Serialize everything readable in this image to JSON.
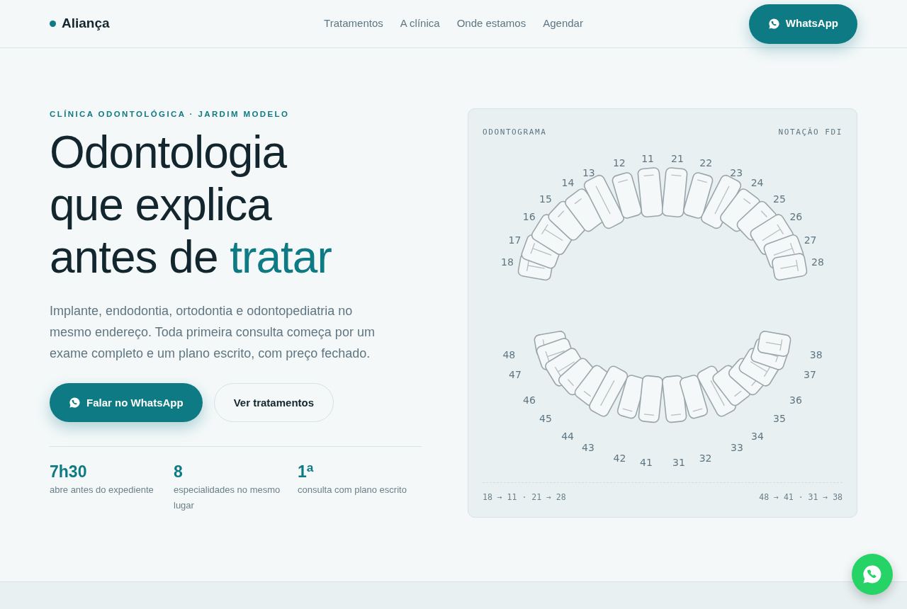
{
  "nav": {
    "brand": "Aliança",
    "links": [
      "Tratamentos",
      "A clínica",
      "Onde estamos",
      "Agendar"
    ],
    "cta": "WhatsApp"
  },
  "hero": {
    "eyebrow": "CLÍNICA ODONTOLÓGICA · JARDIM MODELO",
    "headline": {
      "lines": [
        "Odontologia",
        "que explica",
        "antes de "
      ],
      "accent": "tratar"
    },
    "lead": "Implante, endodontia, ortodontia e odontopediatria no mesmo endereço. Toda primeira consulta começa por um exame completo e um plano escrito, com preço fechado.",
    "primary_button": "Falar no WhatsApp",
    "secondary_button": "Ver tratamentos",
    "stats": [
      {
        "value": "7h30",
        "label": "abre antes do expediente"
      },
      {
        "value": "8",
        "label": "especialidades no mesmo lugar"
      },
      {
        "value": "1$^{a}$",
        "label": "consulta com plano escrito"
      }
    ]
  },
  "odontogram": {
    "title": "ODONTOGRAMA",
    "notation": "NOTAÇÃO FDI",
    "upper_teeth": [
      "18",
      "17",
      "16",
      "15",
      "14",
      "13",
      "12",
      "11",
      "21",
      "22",
      "23",
      "24",
      "25",
      "26",
      "27",
      "28"
    ],
    "lower_teeth": [
      "48",
      "47",
      "46",
      "45",
      "44",
      "43",
      "42",
      "41",
      "31",
      "32",
      "33",
      "34",
      "35",
      "36",
      "37",
      "38"
    ],
    "upper_order": "18 → 11 · 21 → 28",
    "lower_order": "48 → 41 · 31 → 38"
  }
}
